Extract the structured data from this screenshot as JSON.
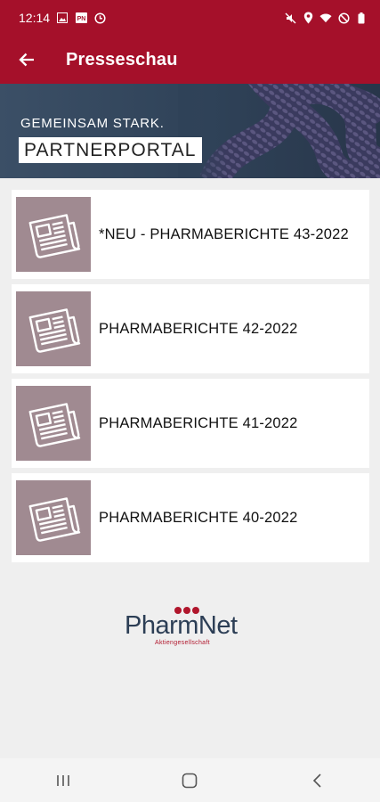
{
  "status_bar": {
    "time": "12:14",
    "icons_left": [
      "image-icon",
      "pn-icon",
      "clock-icon"
    ],
    "icons_right": [
      "mute-icon",
      "location-icon",
      "wifi-icon",
      "dnd-icon",
      "battery-icon"
    ]
  },
  "app_bar": {
    "title": "Presseschau",
    "back_icon": "arrow-left-icon"
  },
  "banner": {
    "tagline": "GEMEINSAM STARK.",
    "portal": "PARTNERPORTAL"
  },
  "items": [
    {
      "label": "*NEU - PHARMABERICHTE 43-2022",
      "icon": "newspaper-icon"
    },
    {
      "label": "PHARMABERICHTE 42-2022",
      "icon": "newspaper-icon"
    },
    {
      "label": "PHARMABERICHTE 41-2022",
      "icon": "newspaper-icon"
    },
    {
      "label": "PHARMABERICHTE 40-2022",
      "icon": "newspaper-icon"
    }
  ],
  "logo": {
    "name": "PharmNet",
    "subtitle": "Aktiengesellschaft"
  },
  "colors": {
    "primary": "#a5102a",
    "thumb": "#a08a91",
    "background": "#efefef",
    "logo_text": "#2c3e55"
  },
  "nav": [
    "recents-icon",
    "home-icon",
    "back-icon"
  ]
}
